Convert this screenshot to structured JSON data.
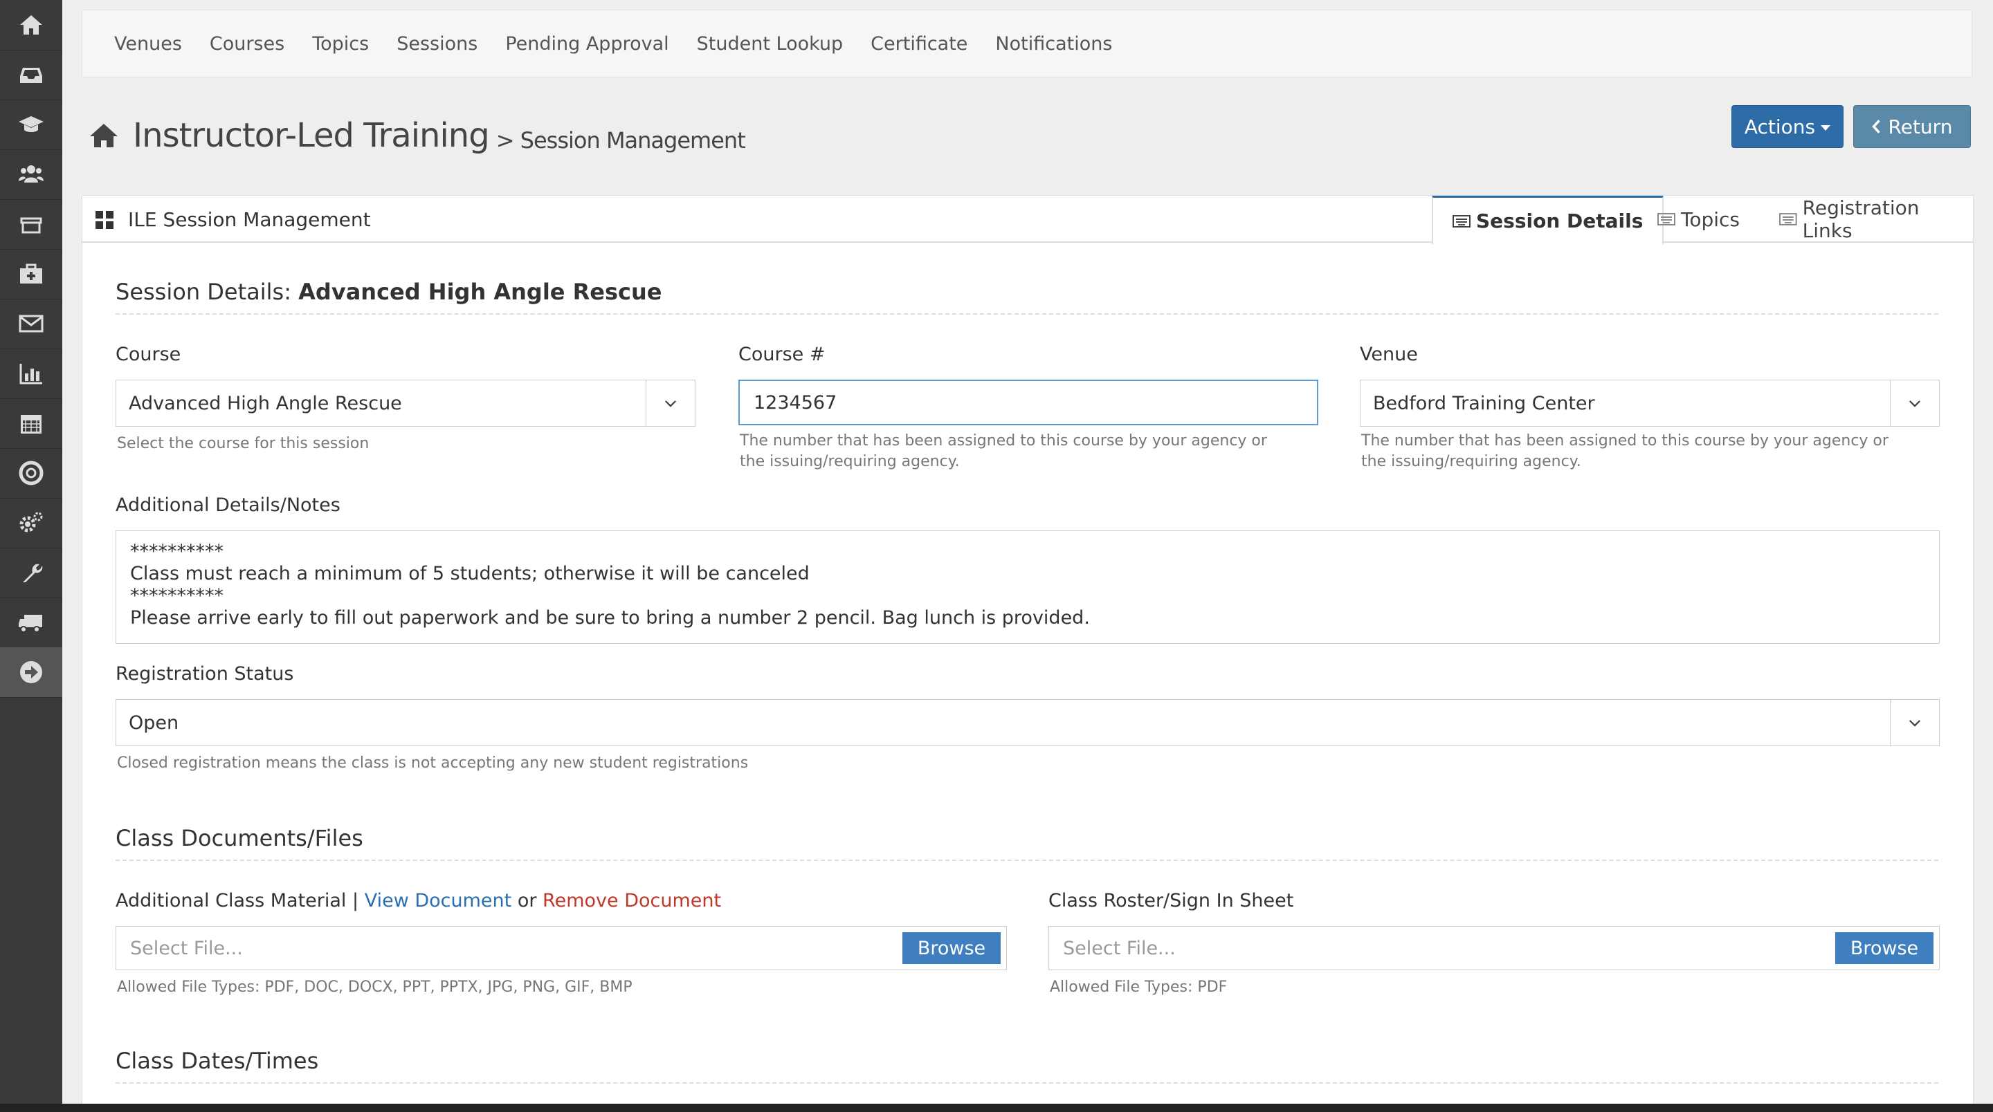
{
  "sidebar": {
    "icons": [
      "home-icon",
      "inbox-icon",
      "graduation-cap-icon",
      "users-icon",
      "archive-icon",
      "medkit-icon",
      "envelope-icon",
      "bar-chart-icon",
      "calendar-icon",
      "life-ring-icon",
      "gears-icon",
      "wrench-icon",
      "truck-icon",
      "sign-out-icon"
    ]
  },
  "nav": {
    "items": [
      "Venues",
      "Courses",
      "Topics",
      "Sessions",
      "Pending Approval",
      "Student Lookup",
      "Certificate",
      "Notifications"
    ]
  },
  "header": {
    "title": "Instructor-Led Training",
    "subtitle": "> Session Management",
    "actions_label": "Actions",
    "return_label": "Return"
  },
  "panel": {
    "title": "ILE Session Management",
    "tabs": [
      "Session Details",
      "Topics",
      "Registration Links"
    ]
  },
  "form": {
    "section_prefix": "Session Details: ",
    "section_name": "Advanced High Angle Rescue",
    "course_label": "Course",
    "course_value": "Advanced High Angle Rescue",
    "course_help": "Select the course for this session",
    "course_num_label": "Course #",
    "course_num_value": "1234567",
    "course_num_help": "The number that has been assigned to this course by your agency or the issuing/requiring agency.",
    "venue_label": "Venue",
    "venue_value": "Bedford Training Center",
    "venue_help": "The number that has been assigned to this course by your agency or the issuing/requiring agency.",
    "notes_label": "Additional Details/Notes",
    "notes_lines": [
      "**********",
      "Class must reach a minimum of 5 students; otherwise it will be canceled",
      "**********",
      "Please arrive early to fill out paperwork and be sure to bring a number 2 pencil. Bag lunch is provided."
    ],
    "status_label": "Registration Status",
    "status_value": "Open",
    "status_help": "Closed registration means the class is not accepting any new student registrations"
  },
  "documents": {
    "title": "Class Documents/Files",
    "material_label": "Additional Class Material | ",
    "view_link": "View Document",
    "or_text": " or ",
    "remove_link": "Remove Document",
    "material_placeholder": "Select File...",
    "browse_label": "Browse",
    "material_help": "Allowed File Types: PDF, DOC, DOCX, PPT, PPTX, JPG, PNG, GIF, BMP",
    "roster_label": "Class Roster/Sign In Sheet",
    "roster_placeholder": "Select File...",
    "roster_help": "Allowed File Types: PDF"
  },
  "dates": {
    "title": "Class Dates/Times"
  }
}
